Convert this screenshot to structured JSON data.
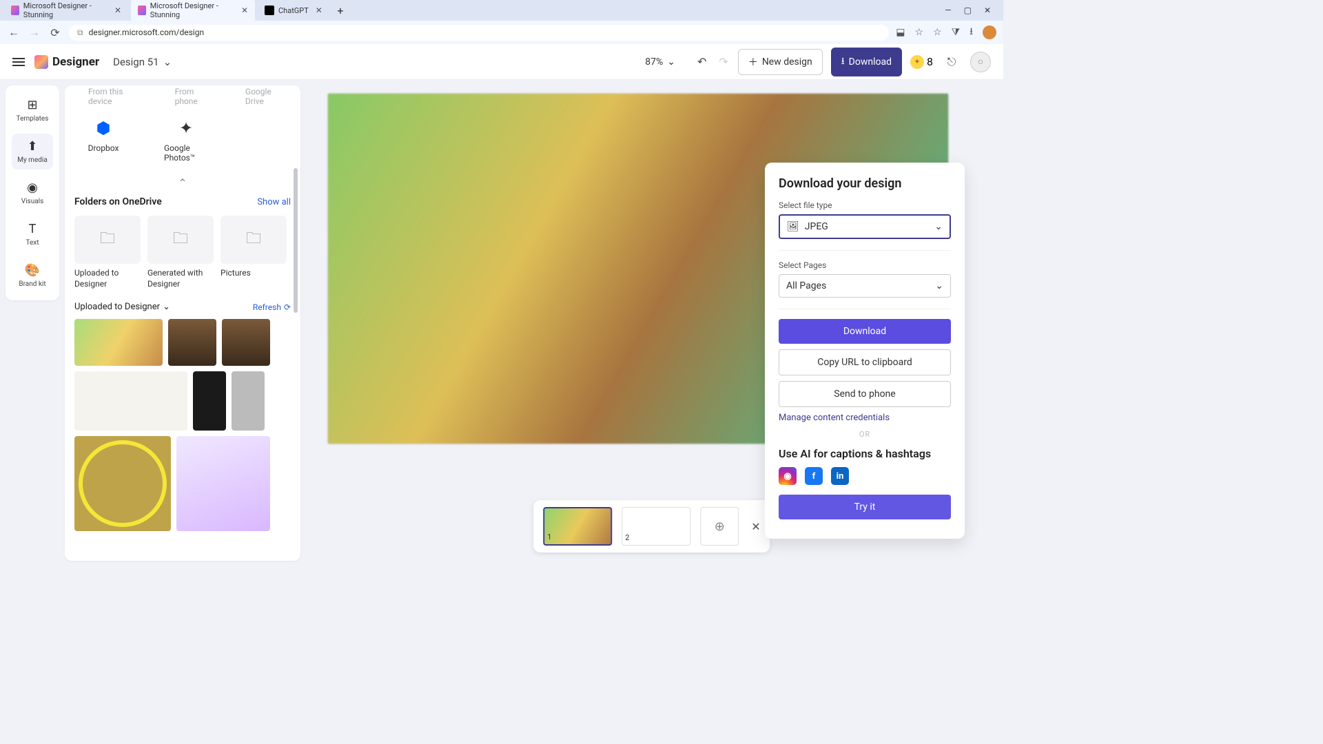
{
  "browser": {
    "tabs": [
      {
        "title": "Microsoft Designer - Stunning"
      },
      {
        "title": "Microsoft Designer - Stunning"
      },
      {
        "title": "ChatGPT"
      }
    ],
    "url": "designer.microsoft.com/design"
  },
  "header": {
    "brand": "Designer",
    "design_title": "Design 51",
    "zoom": "87%",
    "new_design": "New design",
    "download": "Download",
    "coins": "8"
  },
  "rail": {
    "templates": "Templates",
    "my_media": "My media",
    "visuals": "Visuals",
    "text": "Text",
    "brand_kit": "Brand kit"
  },
  "left_panel": {
    "upload_from_device": "From this device",
    "upload_from_phone": "From phone",
    "upload_google_drive": "Google Drive",
    "providers": {
      "dropbox": "Dropbox",
      "google_photos": "Google Photos™"
    },
    "folders_title": "Folders on OneDrive",
    "show_all": "Show all",
    "folders": [
      "Uploaded to Designer",
      "Generated with Designer",
      "Pictures"
    ],
    "uploaded_title": "Uploaded to Designer",
    "refresh": "Refresh"
  },
  "download_panel": {
    "title": "Download your design",
    "filetype_label": "Select file type",
    "filetype_value": "JPEG",
    "pages_label": "Select Pages",
    "pages_value": "All Pages",
    "download_btn": "Download",
    "copy_btn": "Copy URL to clipboard",
    "send_btn": "Send to phone",
    "credentials": "Manage content credentials",
    "or": "OR",
    "ai_title": "Use AI for captions & hashtags",
    "try_it": "Try it"
  },
  "pages": {
    "p1": "1",
    "p2": "2"
  }
}
